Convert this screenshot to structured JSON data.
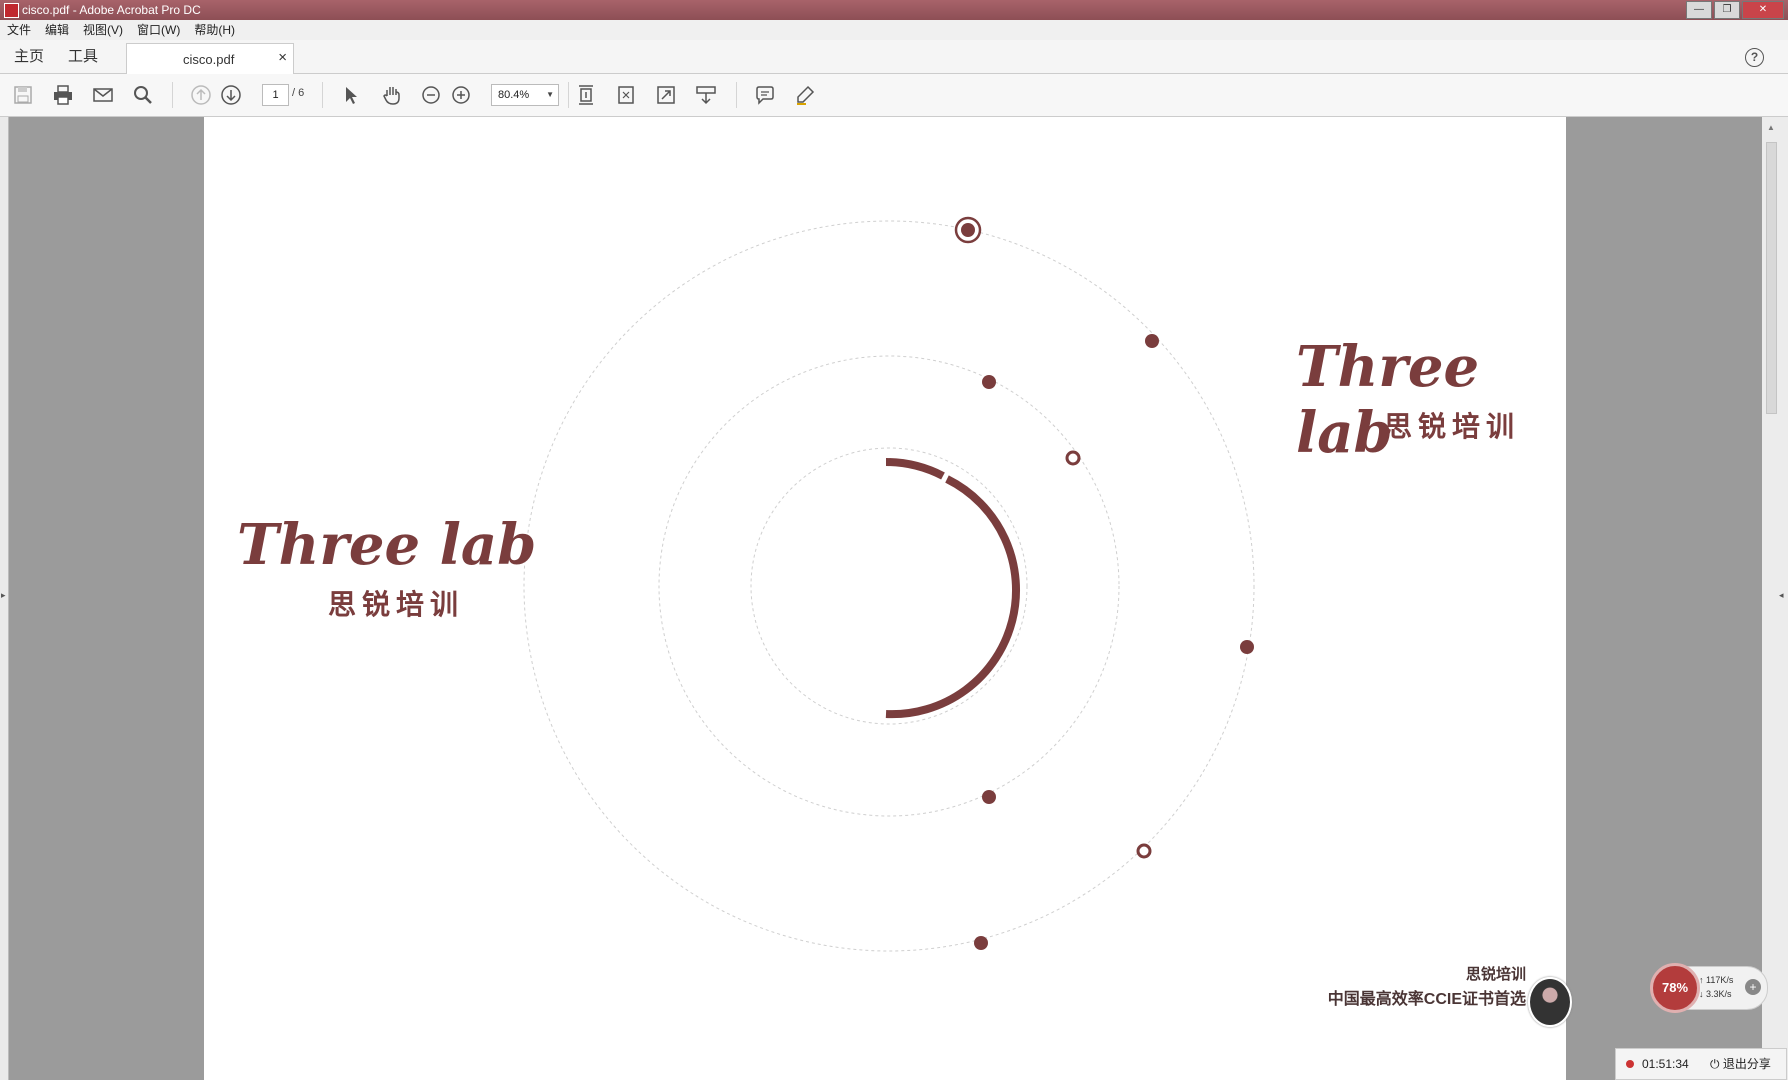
{
  "window": {
    "title": "cisco.pdf - Adobe Acrobat Pro DC",
    "buttons": [
      "—",
      "❐",
      "✕"
    ]
  },
  "menu": [
    "文件",
    "编辑",
    "视图(V)",
    "窗口(W)",
    "帮助(H)"
  ],
  "tabs": {
    "home": "主页",
    "tools": "工具",
    "document": "cisco.pdf",
    "close": "×",
    "help": "?"
  },
  "toolbar": {
    "page_current": "1",
    "page_total": "/ 6",
    "zoom": "80.4%",
    "icons": [
      "save-icon",
      "print-icon",
      "email-icon",
      "search-icon",
      "prev-page-icon",
      "next-page-icon",
      "select-icon",
      "hand-icon",
      "zoom-out-icon",
      "zoom-in-icon",
      "scroll-mode-icon",
      "fit-page-icon",
      "fullscreen-icon",
      "page-extract-icon",
      "comment-icon",
      "highlight-icon"
    ]
  },
  "page": {
    "brand_text": "Three lab",
    "brand_cn": "思锐培训",
    "footer_line1": "思锐培训",
    "footer_line2": "中国最高效率CCIE证书首选",
    "accent_color": "#7a3d3d"
  },
  "widgets": {
    "net_percent": "78%",
    "net_up": "117K/s",
    "net_down": "3.3K/s",
    "rec_time": "01:51:34",
    "exit_share": "退出分享"
  }
}
